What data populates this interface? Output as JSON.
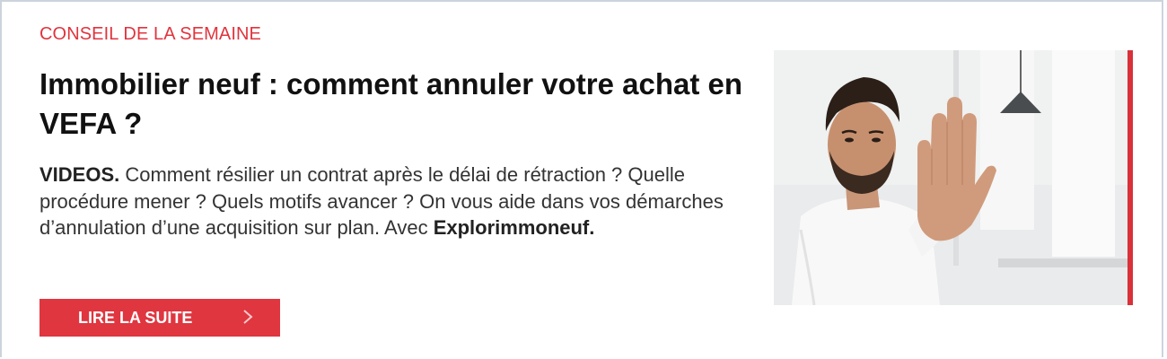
{
  "kicker": "CONSEIL DE LA SEMAINE",
  "title": "Immobilier neuf : comment annuler votre achat en VEFA ?",
  "description": {
    "lead": "VIDEOS.",
    "body": " Comment résilier un contrat après le délai de rétraction ? Quelle procédure mener ? Quels motifs avancer ? On vous aide dans vos démarches d’annulation d’une acquisition sur plan. Avec ",
    "brand": "Explorimmoneuf."
  },
  "cta": {
    "label": "LIRE LA SUITE",
    "icon": "chevron-right-icon"
  },
  "photo": {
    "subject": "man-raising-hand-stop-gesture"
  },
  "colors": {
    "accent": "#df3640",
    "border": "#ccd3dd",
    "title": "#111111",
    "text": "#333333"
  }
}
